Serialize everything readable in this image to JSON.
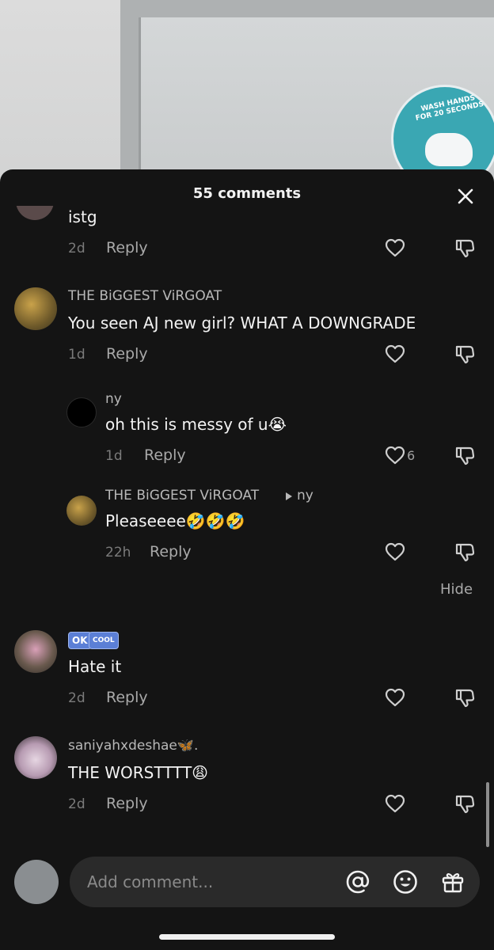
{
  "sheet": {
    "title": "55 comments",
    "close_icon": "close-icon"
  },
  "comments": [
    {
      "text": "istg",
      "time": "2d",
      "reply": "Reply"
    },
    {
      "username": "THE BiGGEST ViRGOAT",
      "text": "You seen AJ new girl? WHAT A DOWNGRADE",
      "time": "1d",
      "reply": "Reply"
    },
    {
      "username": "ny",
      "text": "oh this is messy of u😭",
      "time": "1d",
      "reply": "Reply",
      "likes": "6"
    },
    {
      "username": "THE BiGGEST ViRGOAT",
      "reply_to": "ny",
      "text": "Pleaseeee🤣🤣🤣",
      "time": "22h",
      "reply": "Reply"
    },
    {
      "badge_ok": "OK",
      "badge_cool": "COOL",
      "text": "Hate it",
      "time": "2d",
      "reply": "Reply"
    },
    {
      "username": "saniyahxdeshae🦋.",
      "text": "THE WORSTTTT😩",
      "time": "2d",
      "reply": "Reply"
    }
  ],
  "hide_label": "Hide",
  "composer": {
    "placeholder": "Add comment...",
    "icons": [
      "at-icon",
      "emoji-icon",
      "gift-icon"
    ]
  },
  "colors": {
    "sheet_bg": "#141414",
    "input_bg": "#2a2a2a",
    "secondary_text": "#a9a9a9"
  }
}
